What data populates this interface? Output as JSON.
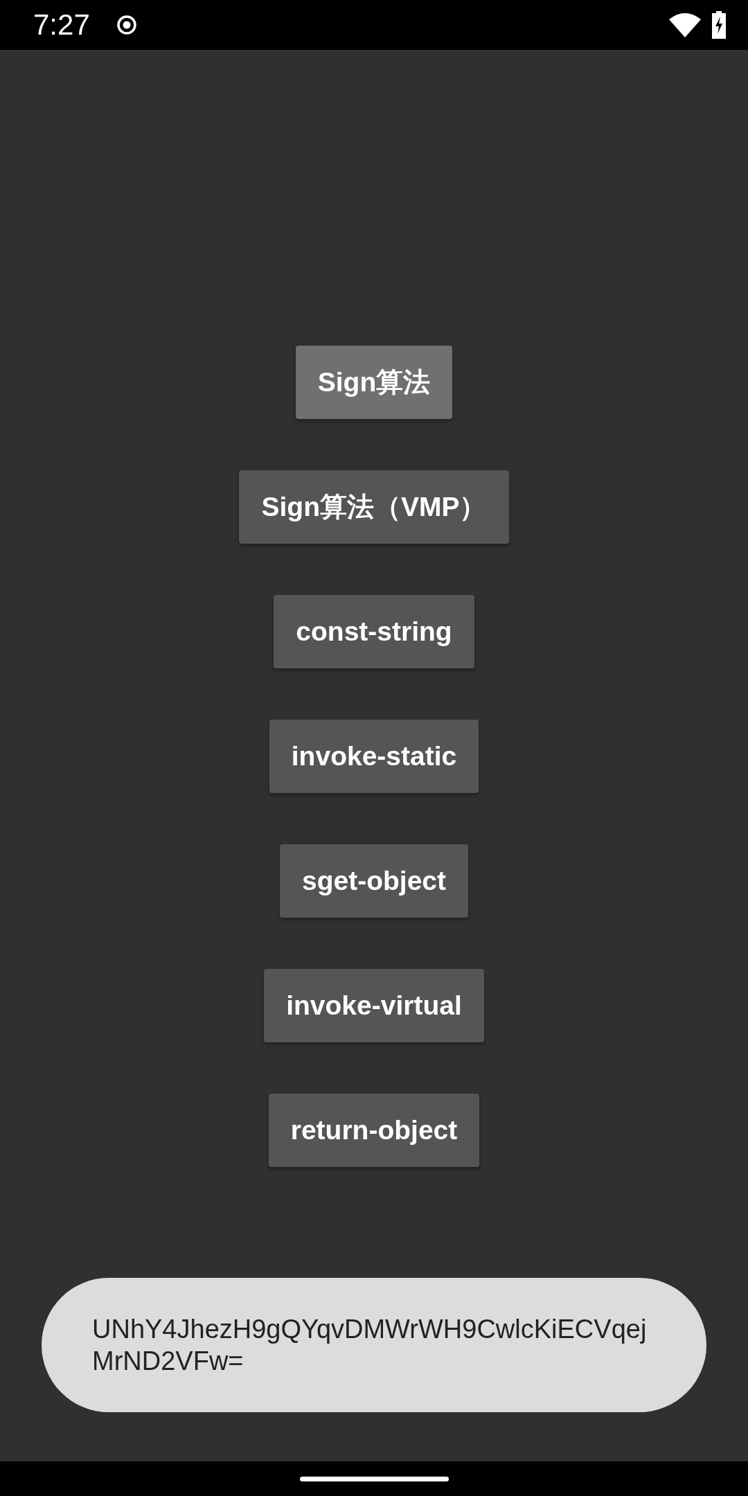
{
  "status_bar": {
    "time": "7:27"
  },
  "buttons": [
    {
      "label": "Sign算法",
      "pressed": true
    },
    {
      "label": "Sign算法（VMP）",
      "pressed": false
    },
    {
      "label": "const-string",
      "pressed": false
    },
    {
      "label": "invoke-static",
      "pressed": false
    },
    {
      "label": "sget-object",
      "pressed": false
    },
    {
      "label": "invoke-virtual",
      "pressed": false
    },
    {
      "label": "return-object",
      "pressed": false
    }
  ],
  "toast": {
    "message": "UNhY4JhezH9gQYqvDMWrWH9CwlcKiECVqejMrND2VFw="
  }
}
